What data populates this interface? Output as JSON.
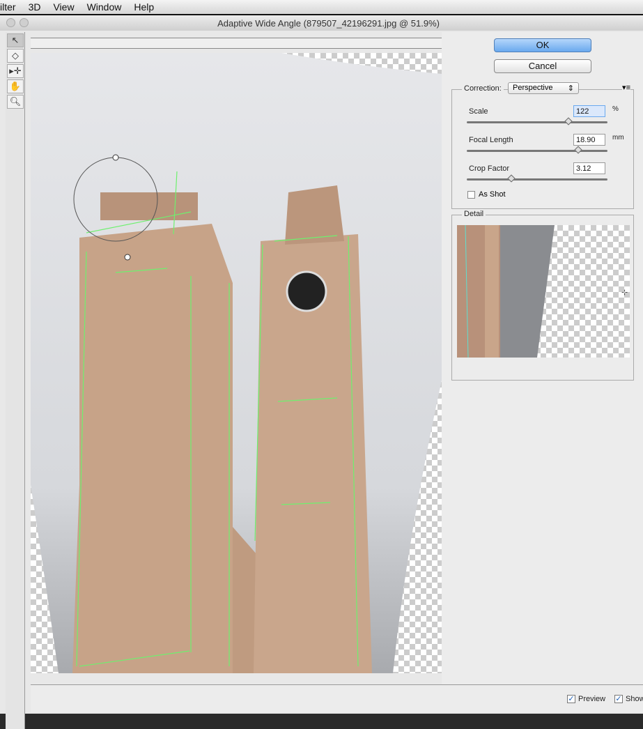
{
  "menubar": {
    "items": [
      "ilter",
      "3D",
      "View",
      "Window",
      "Help"
    ]
  },
  "window": {
    "title": "Adaptive Wide Angle (879507_42196291.jpg @ 51.9%)"
  },
  "tools": [
    {
      "icon": "constraint-tool-icon",
      "active": true
    },
    {
      "icon": "polygon-constraint-tool-icon"
    },
    {
      "icon": "move-tool-icon"
    },
    {
      "icon": "hand-tool-icon"
    },
    {
      "icon": "zoom-tool-icon"
    }
  ],
  "panel": {
    "ok_label": "OK",
    "cancel_label": "Cancel",
    "correction": {
      "label": "Correction:",
      "value": "Perspective"
    },
    "scale": {
      "label": "Scale",
      "value": "122",
      "unit": "%",
      "slider": 0.67
    },
    "focal_length": {
      "label": "Focal Length",
      "value": "18.90",
      "unit": "mm",
      "slider": 0.73
    },
    "crop_factor": {
      "label": "Crop Factor",
      "value": "3.12",
      "slider": 0.31
    },
    "as_shot": {
      "label": "As Shot",
      "checked": false
    },
    "detail": {
      "label": "Detail"
    }
  },
  "bottom": {
    "preview": {
      "label": "Preview",
      "checked": true
    },
    "show": {
      "label": "Show",
      "checked": true
    }
  },
  "colors": {
    "constraint_line": "#6ef06e",
    "building": "#c9a58a",
    "accent": "#6aa9ee"
  }
}
